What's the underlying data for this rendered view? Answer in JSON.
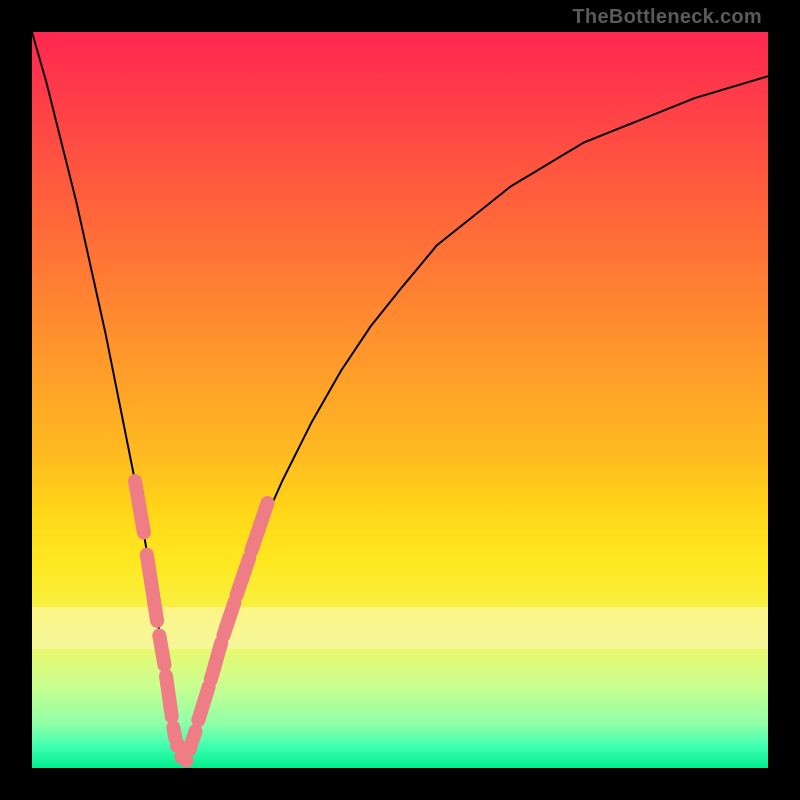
{
  "watermark": "TheBottleneck.com",
  "chart_data": {
    "type": "line",
    "title": "",
    "xlabel": "",
    "ylabel": "",
    "xlim": [
      0,
      100
    ],
    "ylim": [
      0,
      100
    ],
    "grid": false,
    "series": [
      {
        "name": "curve",
        "color": "#000000",
        "x": [
          0,
          2,
          4,
          6,
          8,
          10,
          12,
          14,
          16,
          18,
          19,
          20,
          21,
          22,
          24,
          26,
          28,
          30,
          34,
          38,
          42,
          46,
          50,
          55,
          60,
          65,
          70,
          75,
          80,
          85,
          90,
          95,
          100
        ],
        "y": [
          100,
          93,
          85,
          77,
          68,
          59,
          49,
          39,
          27,
          14,
          7,
          3,
          1,
          4,
          11,
          18,
          24,
          30,
          39,
          47,
          54,
          60,
          65,
          71,
          75,
          79,
          82,
          85,
          87,
          89,
          91,
          92.5,
          94
        ]
      }
    ],
    "annotations": [
      {
        "type": "overlay-segments",
        "color": "#ee7d86",
        "description": "salmon dashed segments along curve near bottom",
        "segments": [
          {
            "x": [
              14,
              15.2
            ],
            "y": [
              39,
              32
            ]
          },
          {
            "x": [
              15.6,
              17
            ],
            "y": [
              29,
              20
            ]
          },
          {
            "x": [
              17.3,
              18
            ],
            "y": [
              18,
              14
            ]
          },
          {
            "x": [
              18.2,
              19
            ],
            "y": [
              12.5,
              7
            ]
          },
          {
            "x": [
              19.2,
              19.5
            ],
            "y": [
              5.5,
              4
            ]
          },
          {
            "x": [
              19.7,
              20
            ],
            "y": [
              3,
              3
            ]
          },
          {
            "x": [
              20.3,
              21
            ],
            "y": [
              1.5,
              1
            ]
          },
          {
            "x": [
              21.4,
              22.2
            ],
            "y": [
              2.5,
              5
            ]
          },
          {
            "x": [
              22.6,
              24
            ],
            "y": [
              6.5,
              11
            ]
          },
          {
            "x": [
              24.3,
              25.7
            ],
            "y": [
              12,
              17
            ]
          },
          {
            "x": [
              26,
              27.5
            ],
            "y": [
              18,
              22.5
            ]
          },
          {
            "x": [
              27.8,
              29.5
            ],
            "y": [
              23.5,
              28.5
            ]
          },
          {
            "x": [
              29.8,
              32
            ],
            "y": [
              29.5,
              36
            ]
          }
        ]
      }
    ],
    "pale_band": {
      "description": "pale yellow horizontal band",
      "y_range_pct_from_top": [
        78,
        84
      ]
    }
  }
}
